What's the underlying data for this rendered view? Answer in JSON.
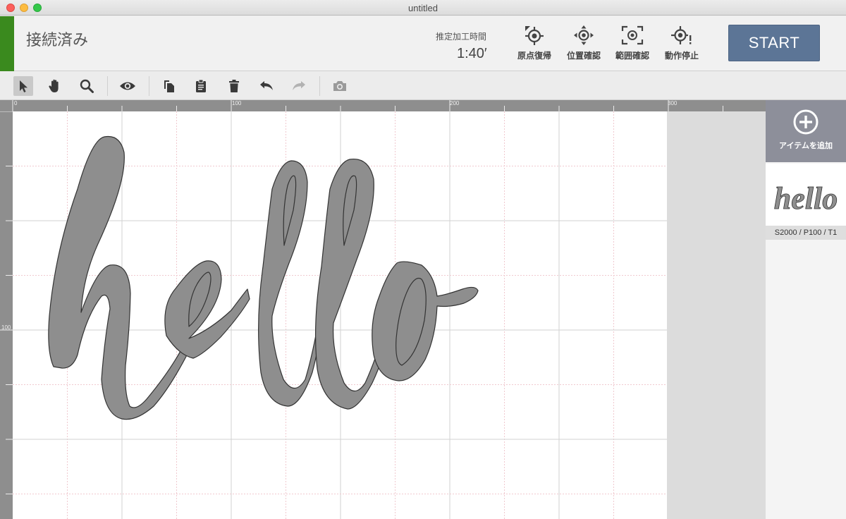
{
  "window": {
    "title": "untitled"
  },
  "header": {
    "connection_status": "接続済み",
    "time_label": "推定加工時間",
    "time_value": "1:40′",
    "buttons": {
      "origin_return": "原点復帰",
      "position_check": "位置確認",
      "range_check": "範囲確認",
      "stop": "動作停止"
    },
    "start_label": "START"
  },
  "toolbar": {
    "tools": [
      "select-arrow-icon",
      "hand-pan-icon",
      "zoom-magnifier-icon",
      "eye-preview-icon",
      "copy-icon",
      "paste-clipboard-icon",
      "trash-icon",
      "undo-icon",
      "redo-icon",
      "camera-icon"
    ],
    "active_tool": "select-arrow-icon"
  },
  "ruler": {
    "top_labels": [
      "0",
      "100",
      "200",
      "300"
    ],
    "left_labels": [
      "100"
    ]
  },
  "canvas": {
    "artwork_text": "hello"
  },
  "side_panel": {
    "add_item_label": "アイテムを追加",
    "items": [
      {
        "thumb_text": "hello",
        "params": "S2000 / P100 / T1"
      }
    ]
  },
  "colors": {
    "connection_green": "#3a8a1e",
    "start_blue": "#5c7596",
    "artwork_fill": "#8e8e8e",
    "add_panel_gray": "#8d8f9a"
  }
}
